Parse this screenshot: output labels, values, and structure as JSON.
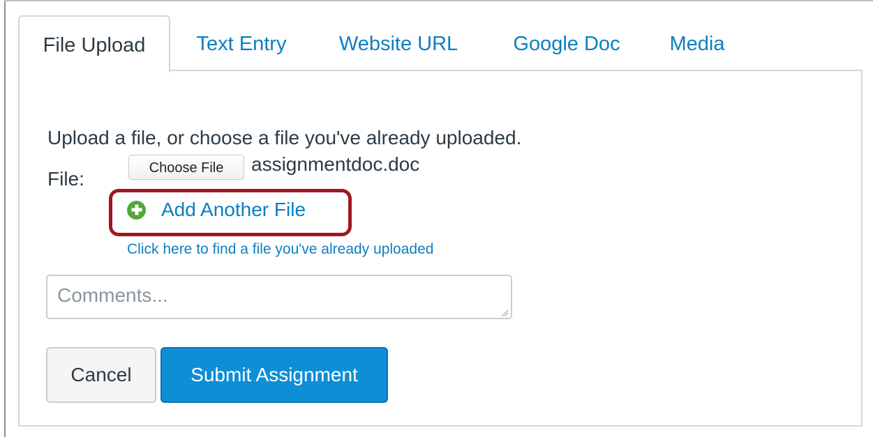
{
  "tabs": [
    {
      "label": "File Upload",
      "active": true
    },
    {
      "label": "Text Entry",
      "active": false
    },
    {
      "label": "Website URL",
      "active": false
    },
    {
      "label": "Google Doc",
      "active": false
    },
    {
      "label": "Media",
      "active": false
    }
  ],
  "upload": {
    "intro": "Upload a file, or choose a file you've already uploaded.",
    "file_label": "File:",
    "choose_file_label": "Choose File",
    "file_name": "assignmentdoc.doc",
    "add_another_label": "Add Another File",
    "find_file_link": "Click here to find a file you've already uploaded"
  },
  "comments": {
    "placeholder": "Comments...",
    "value": ""
  },
  "actions": {
    "cancel_label": "Cancel",
    "submit_label": "Submit Assignment"
  },
  "colors": {
    "link": "#0c7ec1",
    "primary": "#0e8ed5",
    "highlight": "#a0171e",
    "add_icon": "#53a638"
  },
  "icons": {
    "add_another": "plus-circle-icon"
  }
}
